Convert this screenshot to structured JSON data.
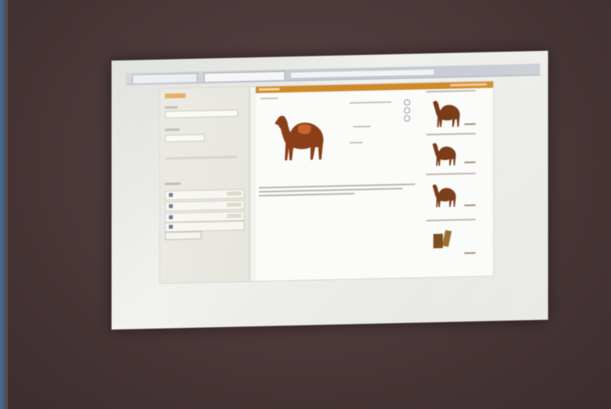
{
  "scene": {
    "description_colors": {
      "wall": "#4e3b3c",
      "screen": "#e8e9e5",
      "accent": "#cf8a2c"
    }
  },
  "icons": {
    "main_product": "camel-icon",
    "related_1": "camel-icon",
    "related_2": "camel-icon",
    "related_3": "camel-icon",
    "related_4": "leather-goods-icon"
  }
}
